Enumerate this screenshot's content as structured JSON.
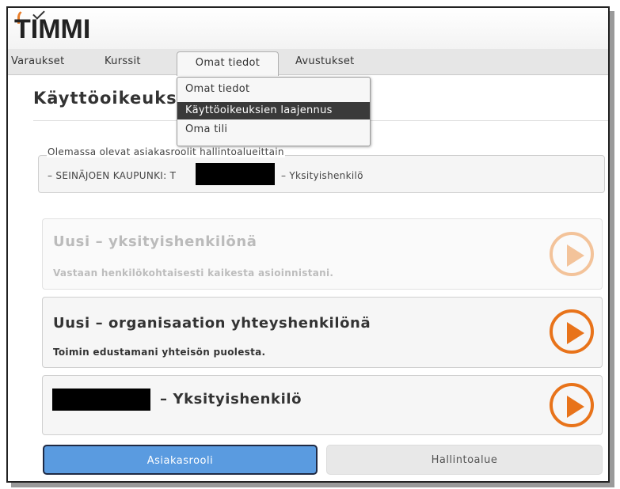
{
  "app": {
    "logo": "TIMMI"
  },
  "nav": {
    "items": [
      "Varaukset",
      "Kurssit",
      "Omat tiedot",
      "Avustukset"
    ],
    "active": "Omat tiedot"
  },
  "dropdown": {
    "items": [
      "Omat tiedot",
      "Käyttöoikeuksien laajennus",
      "Oma tili"
    ],
    "selected": "Käyttöoikeuksien laajennus"
  },
  "page": {
    "title": "Käyttöoikeuks"
  },
  "existing_roles": {
    "legend": "Olemassa olevat asiakasroolit hallintoalueittain",
    "row_prefix": "– SEINÄJOEN KAUPUNKI: ",
    "row_prefix_char": "T",
    "row_suffix": "– Yksityishenkilö"
  },
  "options": [
    {
      "title": "Uusi – yksityishenkilönä",
      "subtitle": "Vastaan henkilökohtaisesti kaikesta asioinnistani.",
      "enabled": false
    },
    {
      "title": "Uusi – organisaation yhteyshenkilönä",
      "subtitle": "Toimin edustamani yhteisön puolesta.",
      "enabled": true
    },
    {
      "title": "– Yksityishenkilö",
      "subtitle": "",
      "enabled": true
    }
  ],
  "tabs": {
    "primary": "Asiakasrooli",
    "secondary": "Hallintoalue"
  },
  "colors": {
    "accent": "#e8731a",
    "primary_button": "#5a9be0",
    "menu_selected": "#3a3a3a"
  }
}
